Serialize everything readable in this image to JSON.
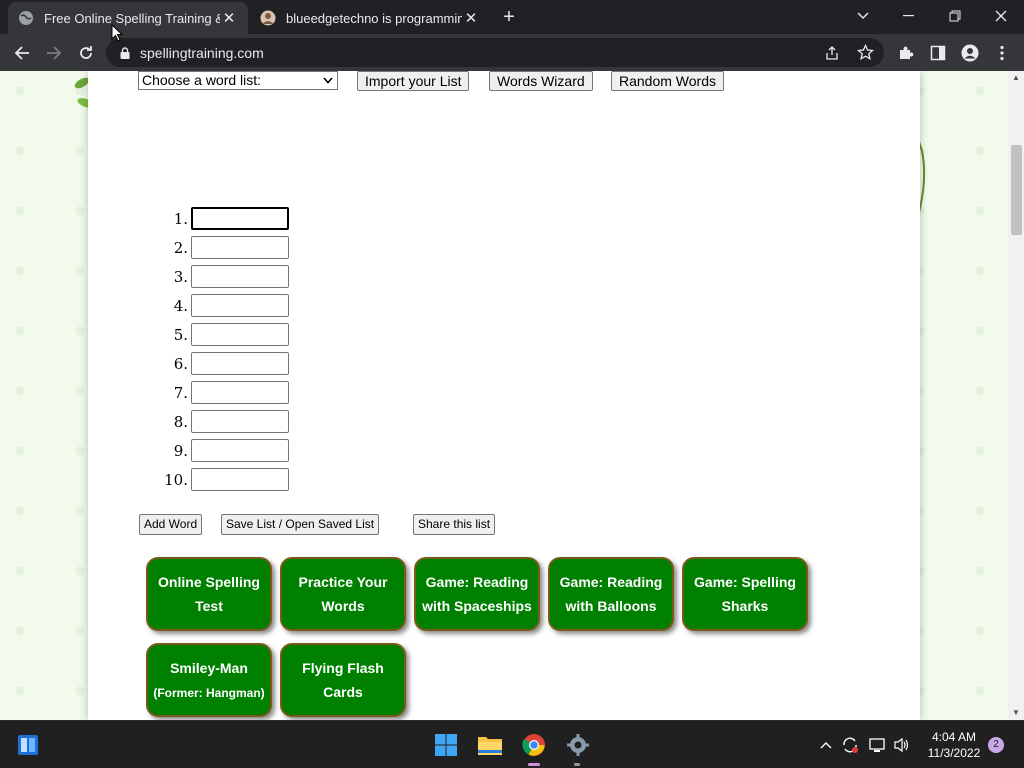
{
  "browser": {
    "tabs": [
      {
        "title": "Free Online Spelling Training & G",
        "close": "✕"
      },
      {
        "title": "blueedgetechno is programming",
        "close": "✕"
      }
    ],
    "new_tab": "+",
    "url": "spellingtraining.com"
  },
  "page": {
    "word_list_select": "Choose a word list:",
    "import_button": "Import your List",
    "wizard_button": "Words Wizard",
    "random_button": "Random Words",
    "word_numbers": [
      "1.",
      "2.",
      "3.",
      "4.",
      "5.",
      "6.",
      "7.",
      "8.",
      "9.",
      "10."
    ],
    "add_word_button": "Add Word",
    "save_button": "Save List / Open Saved List",
    "share_button": "Share this list",
    "activities": [
      {
        "line1": "Online Spelling",
        "line2": "Test"
      },
      {
        "line1": "Practice Your",
        "line2": "Words"
      },
      {
        "line1": "Game: Reading",
        "line2": "with Spaceships"
      },
      {
        "line1": "Game: Reading",
        "line2": "with Balloons"
      },
      {
        "line1": "Game: Spelling",
        "line2": "Sharks"
      },
      {
        "line1": "Smiley-Man",
        "line2": "(Former: Hangman)"
      },
      {
        "line1": "Flying Flash",
        "line2": "Cards"
      }
    ]
  },
  "taskbar": {
    "time": "4:04 AM",
    "date": "11/3/2022",
    "notifications": "2"
  },
  "colors": {
    "button_green": "#008000",
    "button_border": "#7a5a1a",
    "chrome_dark": "#202124",
    "chrome_toolbar": "#35363a"
  }
}
